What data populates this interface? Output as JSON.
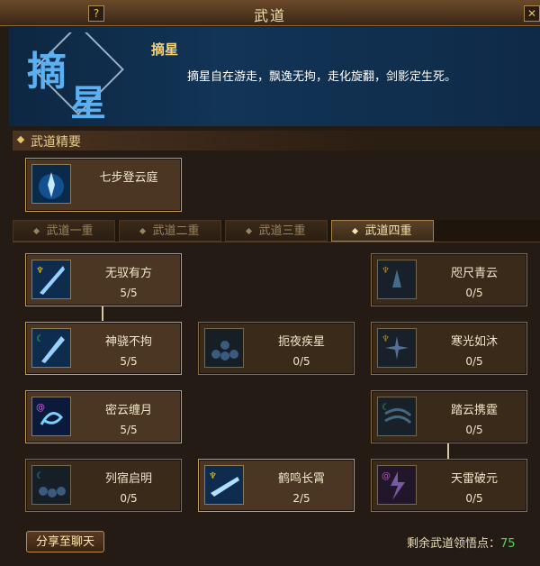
{
  "window": {
    "title": "武道",
    "help_label": "?",
    "close_label": "✕"
  },
  "header": {
    "emblem_text": "摘星",
    "skill_name": "摘星",
    "skill_desc": "摘星自在游走，飘逸无拘，走化旋翻，剑影定生死。"
  },
  "essentials": {
    "label": "武道精要",
    "card": {
      "name": "七步登云庭",
      "icon": "ninja-figure-icon"
    }
  },
  "tabs": [
    "武道一重",
    "武道二重",
    "武道三重",
    "武道四重"
  ],
  "active_tab": 3,
  "skills": [
    {
      "name": "无驭有方",
      "level": "5/5",
      "icon": "blade-icon",
      "active": true
    },
    {
      "name": "咫尺青云",
      "level": "0/5",
      "icon": "shadow-figure-icon",
      "active": false
    },
    {
      "name": "神骁不拘",
      "level": "5/5",
      "icon": "blade-icon",
      "active": true
    },
    {
      "name": "扼夜疾星",
      "level": "0/5",
      "icon": "orbs-icon",
      "active": false
    },
    {
      "name": "寒光如沐",
      "level": "0/5",
      "icon": "sparkle-icon",
      "active": false
    },
    {
      "name": "密云缠月",
      "level": "5/5",
      "icon": "swirl-icon",
      "active": true
    },
    {
      "name": "踏云携霆",
      "level": "0/5",
      "icon": "wind-icon",
      "active": false
    },
    {
      "name": "列宿启明",
      "level": "0/5",
      "icon": "orbs-icon",
      "active": false
    },
    {
      "name": "鹤鸣长霄",
      "level": "2/5",
      "icon": "cloud-blade-icon",
      "active": true
    },
    {
      "name": "天雷破元",
      "level": "0/5",
      "icon": "lightning-figure-icon",
      "active": false
    }
  ],
  "footer": {
    "share_label": "分享至聊天",
    "points_label": "剩余武道领悟点：",
    "points_value": "75"
  },
  "colors": {
    "accent_gold": "#f3d27a",
    "points_green": "#58d05a",
    "header_blue": "#123456"
  }
}
